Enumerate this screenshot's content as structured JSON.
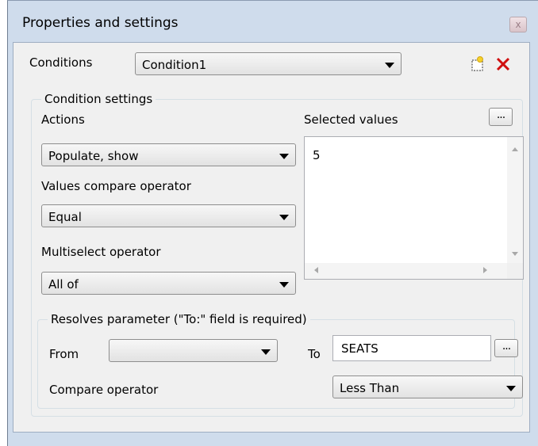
{
  "window": {
    "title": "Properties and settings",
    "close_glyph": "x"
  },
  "conditions": {
    "label": "Conditions",
    "value": "Condition1",
    "new_icon": "new-document-icon",
    "delete_icon": "delete-x-icon"
  },
  "condition_settings": {
    "group_label": "Condition settings",
    "actions": {
      "label": "Actions",
      "value": "Populate, show"
    },
    "compare": {
      "label": "Values compare operator",
      "value": "Equal"
    },
    "multiselect": {
      "label": "Multiselect operator",
      "value": "All of"
    },
    "selected_values": {
      "label": "Selected values",
      "button": "...",
      "items": [
        "5"
      ]
    }
  },
  "resolves": {
    "group_label": "Resolves parameter (\"To:\" field is required)",
    "from_label": "From",
    "from_value": "",
    "to_label": "To",
    "to_value": "SEATS",
    "to_button": "...",
    "compare_label": "Compare operator",
    "compare_value": "Less Than"
  },
  "colors": {
    "delete": "#d01010",
    "frame": "#cfdcec",
    "client": "#f0f0f0"
  }
}
